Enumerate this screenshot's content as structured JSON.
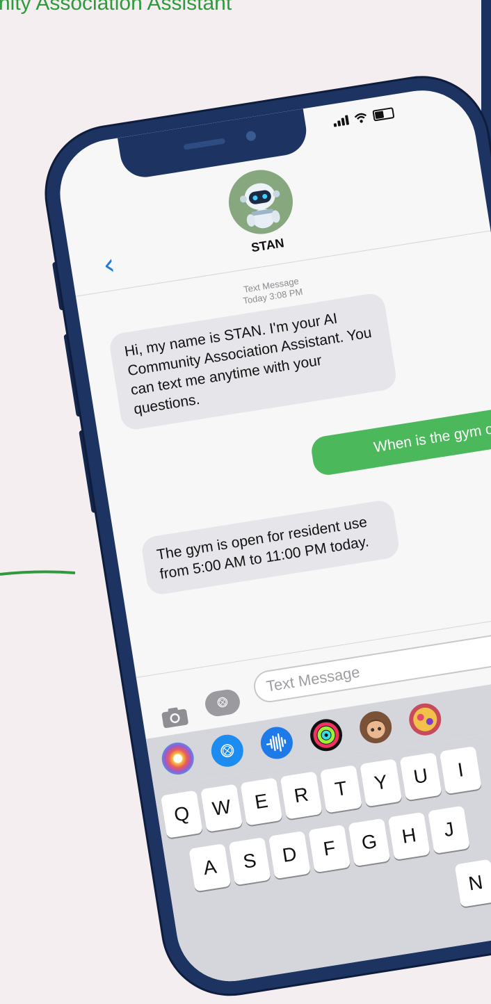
{
  "header": {
    "title": "nity Association Assistant"
  },
  "status_bar": {
    "icons": [
      "signal-icon",
      "wifi-icon",
      "battery-icon"
    ]
  },
  "contact": {
    "name": "STAN",
    "avatar_icon": "robot-icon"
  },
  "thread": {
    "meta_line1": "Text Message",
    "meta_line2": "Today 3:08 PM",
    "messages": [
      {
        "from": "bot",
        "text": "Hi, my name is STAN. I'm your AI Community Association Assistant. You can text me anytime with your questions."
      },
      {
        "from": "user",
        "text": "When is the gym open?"
      },
      {
        "from": "bot",
        "text": "The gym is open for resident use from 5:00 AM to 11:00 PM today."
      }
    ]
  },
  "compose": {
    "placeholder": "Text Message"
  },
  "app_strip": [
    "photos-icon",
    "app-store-icon",
    "audio-icon",
    "activity-icon",
    "memoji-icon",
    "sticker-icon"
  ],
  "keyboard": {
    "row1": [
      "Q",
      "W",
      "E",
      "R",
      "T",
      "Y",
      "U",
      "I"
    ],
    "row2": [
      "A",
      "S",
      "D",
      "F",
      "G",
      "H",
      "J"
    ],
    "row3_partial": [
      "N"
    ]
  },
  "colors": {
    "accent_green": "#4cb85c",
    "phone_frame": "#1d3463",
    "link_blue": "#1e7ae0",
    "header_green": "#2f9a3c"
  }
}
